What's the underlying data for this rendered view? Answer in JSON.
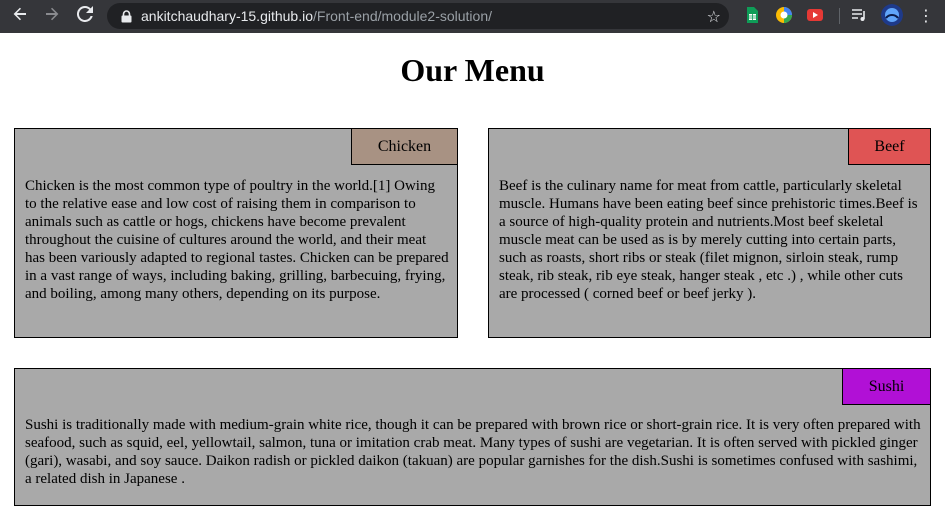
{
  "browser": {
    "url_host": "ankitchaudhary-15.github.io",
    "url_path": "/Front-end/module2-solution/",
    "back_icon": "arrow-left-icon",
    "forward_icon": "arrow-right-icon",
    "reload_icon": "reload-icon",
    "bookmark_icon": "star-icon"
  },
  "page": {
    "title": "Our Menu"
  },
  "items": [
    {
      "tag": "Chicken",
      "tag_color": "#a89283",
      "description": "Chicken is the most common type of poultry in the world.[1] Owing to the relative ease and low cost of raising them in comparison to animals such as cattle or hogs, chickens have become prevalent throughout the cuisine of cultures around the world, and their meat has been variously adapted to regional tastes. Chicken can be prepared in a vast range of ways, including baking, grilling, barbecuing, frying, and boiling, among many others, depending on its purpose."
    },
    {
      "tag": "Beef",
      "tag_color": "#df5454",
      "description": "Beef is the culinary name for meat from cattle, particularly skeletal muscle. Humans have been eating beef since prehistoric times.Beef is a source of high-quality protein and nutrients.Most beef skeletal muscle meat can be used as is by merely cutting into certain parts, such as roasts, short ribs or steak (filet mignon, sirloin steak, rump steak, rib steak, rib eye steak, hanger steak , etc .) , while other cuts are processed ( corned beef or beef jerky )."
    },
    {
      "tag": "Sushi",
      "tag_color": "#b110d6",
      "description": "Sushi is traditionally made with medium-grain white rice, though it can be prepared with brown rice or short-grain rice. It is very often prepared with seafood, such as squid, eel, yellowtail, salmon, tuna or imitation crab meat. Many types of sushi are vegetarian. It is often served with pickled ginger (gari), wasabi, and soy sauce. Daikon radish or pickled daikon (takuan) are popular garnishes for the dish.Sushi is sometimes confused with sashimi, a related dish in Japanese ."
    }
  ]
}
